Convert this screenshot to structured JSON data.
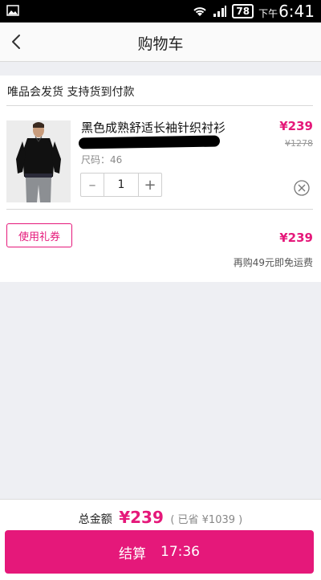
{
  "statusbar": {
    "battery": "78",
    "time_prefix": "下午",
    "time": "6:41"
  },
  "nav": {
    "title": "购物车"
  },
  "shipping": {
    "text": "唯品会发货 支持货到付款"
  },
  "product": {
    "name": "黑色成熟舒适长袖针织衬衫",
    "size": "尺码：46",
    "quantity": "1",
    "price": "¥239",
    "original_price": "¥1278"
  },
  "summary": {
    "coupon_label": "使用礼券",
    "subtotal": "¥239",
    "free_shipping": "再购49元即免运费"
  },
  "footer": {
    "total_label": "总金额",
    "total_amount": "¥239",
    "saved": "( 已省 ¥1039 )",
    "checkout_label": "结算",
    "checkout_timer": "17:36"
  },
  "icons": {
    "back": "chevron-left-icon",
    "remove": "close-circle-icon",
    "gallery": "image-icon",
    "wifi": "wifi-icon",
    "signal": "signal-icon",
    "battery": "battery-icon"
  },
  "colors": {
    "accent": "#e5187a",
    "background": "#eeeff3"
  }
}
